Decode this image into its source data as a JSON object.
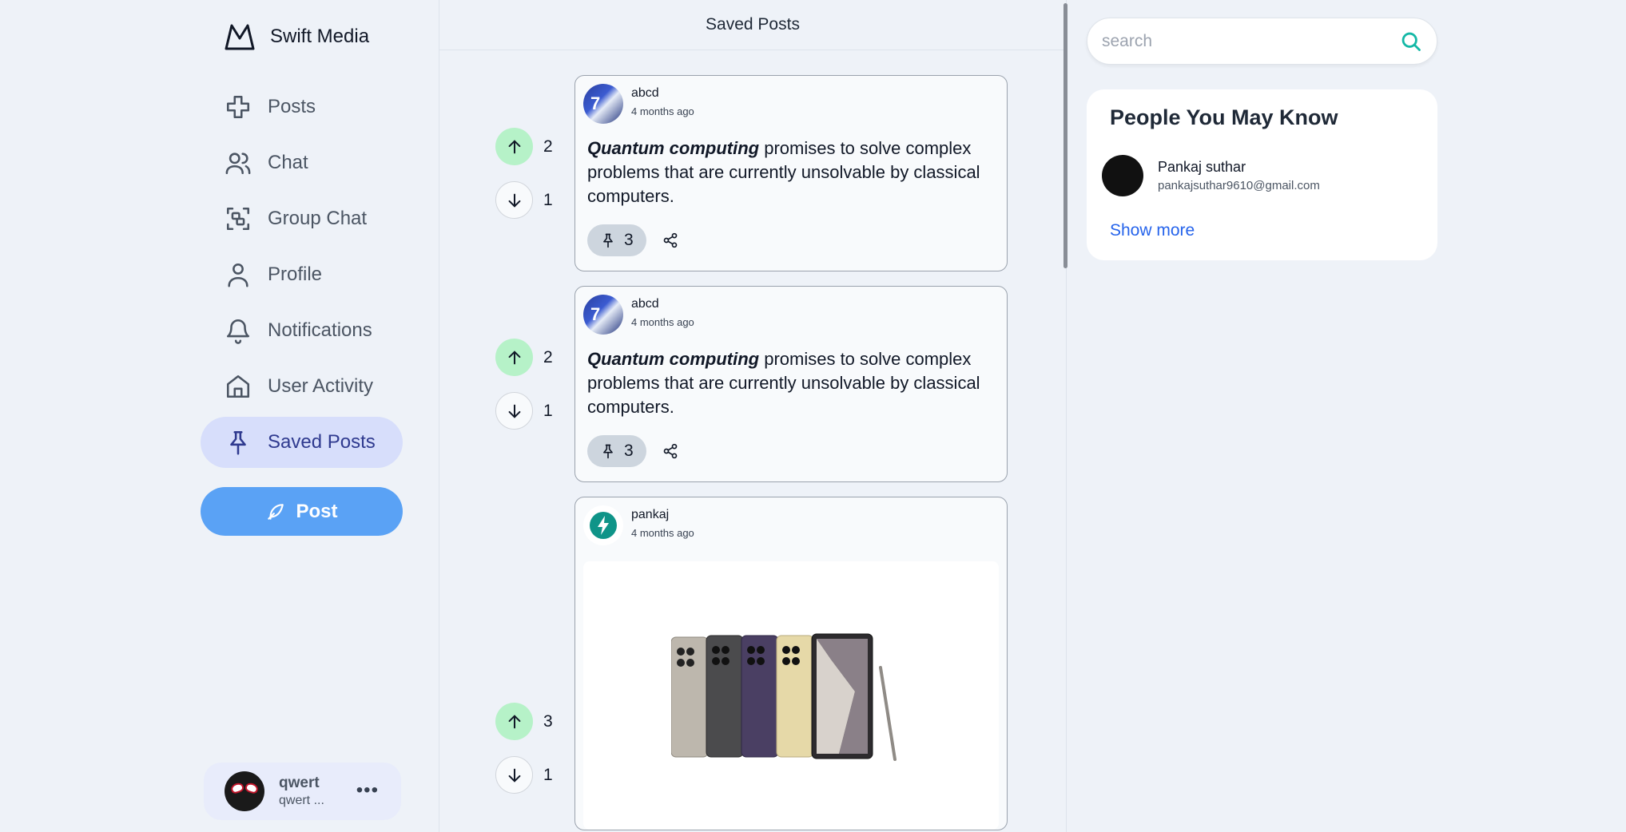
{
  "app": {
    "title": "Swift Media"
  },
  "nav": {
    "items": [
      {
        "label": "Posts",
        "icon": "plus-icon"
      },
      {
        "label": "Chat",
        "icon": "users-icon"
      },
      {
        "label": "Group Chat",
        "icon": "scan-icon"
      },
      {
        "label": "Profile",
        "icon": "user-icon"
      },
      {
        "label": "Notifications",
        "icon": "bell-icon"
      },
      {
        "label": "User Activity",
        "icon": "home-icon"
      },
      {
        "label": "Saved Posts",
        "icon": "pin-icon",
        "active": true
      }
    ],
    "post_button": "Post"
  },
  "current_user": {
    "name": "qwert",
    "handle": "qwert ...",
    "more": "•••"
  },
  "feed": {
    "title": "Saved Posts",
    "posts": [
      {
        "author": "abcd",
        "time": "4 months ago",
        "text_bold": "Quantum computing",
        "text_rest": " promises to solve complex problems that are currently unsolvable by classical computers.",
        "upvotes": "2",
        "downvotes": "1",
        "pins": "3"
      },
      {
        "author": "abcd",
        "time": "4 months ago",
        "text_bold": "Quantum computing",
        "text_rest": " promises to solve complex problems that are currently unsolvable by classical computers.",
        "upvotes": "2",
        "downvotes": "1",
        "pins": "3"
      },
      {
        "author": "pankaj",
        "time": "4 months ago",
        "image": "phones-image",
        "upvotes": "3",
        "downvotes": "1"
      }
    ]
  },
  "search": {
    "placeholder": "search"
  },
  "pymk": {
    "title": "People You May Know",
    "people": [
      {
        "name": "Pankaj suthar",
        "email": "pankajsuthar9610@gmail.com"
      }
    ],
    "show_more": "Show more"
  },
  "colors": {
    "accent": "#5aa2f5",
    "active_nav": "#d7defb",
    "upvote": "#b6f2c8",
    "search_icon": "#14b8a6"
  }
}
